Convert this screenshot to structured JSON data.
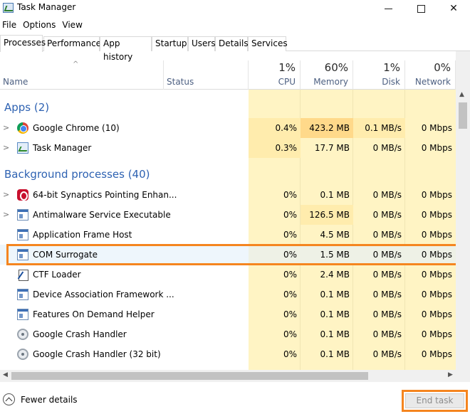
{
  "window": {
    "title": "Task Manager"
  },
  "menu": [
    "File",
    "Options",
    "View"
  ],
  "tabs": [
    "Processes",
    "Performance",
    "App history",
    "Startup",
    "Users",
    "Details",
    "Services"
  ],
  "columns": {
    "name": "Name",
    "status": "Status",
    "cpu": {
      "label": "CPU",
      "percent": "1%"
    },
    "memory": {
      "label": "Memory",
      "percent": "60%"
    },
    "disk": {
      "label": "Disk",
      "percent": "1%"
    },
    "network": {
      "label": "Network",
      "percent": "0%"
    }
  },
  "groups": {
    "apps": "Apps (2)",
    "background": "Background processes (40)"
  },
  "processes": [
    {
      "name": "Google Chrome (10)",
      "icon": "chrome-icon",
      "cpu": "0.4%",
      "memory": "423.2 MB",
      "disk": "0.1 MB/s",
      "network": "0 Mbps"
    },
    {
      "name": "Task Manager",
      "icon": "task-manager-icon",
      "cpu": "0.3%",
      "memory": "17.7 MB",
      "disk": "0 MB/s",
      "network": "0 Mbps"
    },
    {
      "name": "64-bit Synaptics Pointing Enhan...",
      "icon": "synaptics-icon",
      "cpu": "0%",
      "memory": "0.1 MB",
      "disk": "0 MB/s",
      "network": "0 Mbps"
    },
    {
      "name": "Antimalware Service Executable",
      "icon": "window-app-icon",
      "cpu": "0%",
      "memory": "126.5 MB",
      "disk": "0 MB/s",
      "network": "0 Mbps"
    },
    {
      "name": "Application Frame Host",
      "icon": "window-app-icon",
      "cpu": "0%",
      "memory": "4.5 MB",
      "disk": "0 MB/s",
      "network": "0 Mbps"
    },
    {
      "name": "COM Surrogate",
      "icon": "window-app-icon",
      "cpu": "0%",
      "memory": "1.5 MB",
      "disk": "0 MB/s",
      "network": "0 Mbps"
    },
    {
      "name": "CTF Loader",
      "icon": "ctf-loader-icon",
      "cpu": "0%",
      "memory": "2.4 MB",
      "disk": "0 MB/s",
      "network": "0 Mbps"
    },
    {
      "name": "Device Association Framework ...",
      "icon": "window-app-icon",
      "cpu": "0%",
      "memory": "0.1 MB",
      "disk": "0 MB/s",
      "network": "0 Mbps"
    },
    {
      "name": "Features On Demand Helper",
      "icon": "window-app-icon",
      "cpu": "0%",
      "memory": "0.1 MB",
      "disk": "0 MB/s",
      "network": "0 Mbps"
    },
    {
      "name": "Google Crash Handler",
      "icon": "crash-handler-icon",
      "cpu": "0%",
      "memory": "0.1 MB",
      "disk": "0 MB/s",
      "network": "0 Mbps"
    },
    {
      "name": "Google Crash Handler (32 bit)",
      "icon": "crash-handler-icon",
      "cpu": "0%",
      "memory": "0.1 MB",
      "disk": "0 MB/s",
      "network": "0 Mbps"
    }
  ],
  "footer": {
    "fewer_details": "Fewer details",
    "end_task": "End task"
  },
  "colors": {
    "group_text": "#2e62b2",
    "highlight_callout": "#f5851f",
    "heat_light": "#fff4c4",
    "heat_strong": "#ffd98a"
  }
}
